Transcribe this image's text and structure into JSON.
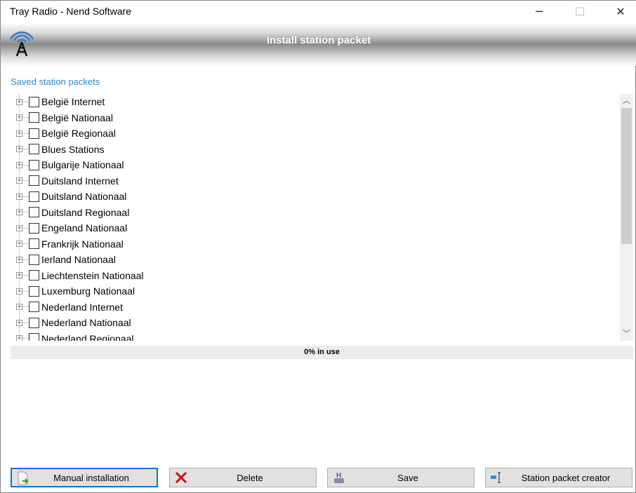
{
  "window": {
    "title": "Tray Radio - Nend Software",
    "minimize": "─",
    "maximize": "☐",
    "close": "✕"
  },
  "header": {
    "title": "Install station packet",
    "logo_icon": "radio-tower-icon"
  },
  "section_label": "Saved station packets",
  "packets": [
    "België Internet",
    "België Nationaal",
    "België Regionaal",
    "Blues Stations",
    "Bulgarije Nationaal",
    "Duitsland Internet",
    "Duitsland Nationaal",
    "Duitsland Regionaal",
    "Engeland Nationaal",
    "Frankrijk Nationaal",
    "Ierland Nationaal",
    "Liechtenstein Nationaal",
    "Luxemburg Nationaal",
    "Nederland Internet",
    "Nederland Nationaal",
    "Nederland Regionaal"
  ],
  "usage": {
    "label": "0% in use",
    "percent": 0
  },
  "buttons": {
    "manual": "Manual installation",
    "delete": "Delete",
    "save": "Save",
    "creator": "Station packet creator"
  }
}
